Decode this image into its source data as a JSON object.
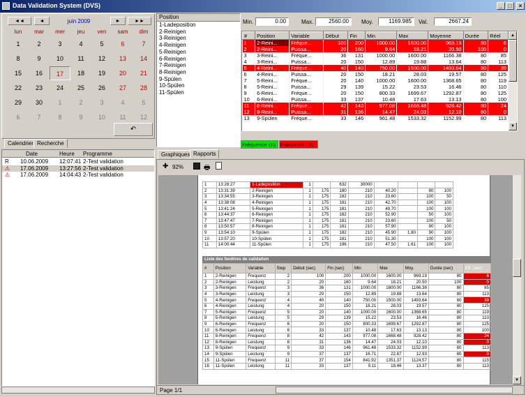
{
  "window": {
    "title": "Data Validation System (DVS)",
    "buttons": [
      "_",
      "□",
      "×"
    ]
  },
  "calendar": {
    "month_label": "juin 2009",
    "nav": [
      "◄◄",
      "◄",
      "►",
      "►►"
    ],
    "dows": [
      "lun",
      "mar",
      "mer",
      "jeu",
      "ven",
      "sam",
      "dim"
    ],
    "weeks": [
      [
        "1",
        "2",
        "3",
        "4",
        "5",
        "6",
        "7"
      ],
      [
        "8",
        "9",
        "10",
        "11",
        "12",
        "13",
        "14"
      ],
      [
        "15",
        "16",
        "17",
        "18",
        "19",
        "20",
        "21"
      ],
      [
        "22",
        "23",
        "24",
        "25",
        "26",
        "27",
        "28"
      ],
      [
        "29",
        "30",
        "1",
        "2",
        "3",
        "4",
        "5"
      ],
      [
        "6",
        "7",
        "8",
        "9",
        "10",
        "11",
        "12"
      ]
    ],
    "today": "17",
    "today_button": "↶",
    "tabs": [
      "Calendrier",
      "Recherche"
    ]
  },
  "positions": {
    "header": "Position",
    "items": [
      "1-Ladeposition",
      "2-Reinigen",
      "3-Reinigen",
      "4-Reinigen",
      "5-Reinigen",
      "6-Reinigen",
      "7-Reinigen",
      "8-Reinigen",
      "9-Spülen",
      "10-Spülen",
      "11-Spülen"
    ]
  },
  "stats": {
    "min_label": "Min.",
    "min": "0.00",
    "max_label": "Max.",
    "max": "2560.00",
    "moy_label": "Moy.",
    "moy": "1169.985",
    "val_label": "Val.",
    "val": "2667.24"
  },
  "grid": {
    "columns": [
      "#",
      "Position",
      "Variable",
      "Début",
      "Fin",
      "Min",
      "Max",
      "Moyenne",
      "Durée",
      "Réel"
    ],
    "rows": [
      {
        "c": [
          "1",
          "2-Reini...",
          "Fréque...",
          "100",
          "200",
          "1000.00",
          "1600.00",
          "969.19",
          "80",
          "6"
        ],
        "s": "selred"
      },
      {
        "c": [
          "2",
          "2-Reini...",
          "Puissa...",
          "20",
          "160",
          "9.64",
          "18.21",
          "20.50",
          "100",
          "0"
        ],
        "s": "red"
      },
      {
        "c": [
          "3",
          "3-Reini...",
          "Fréque...",
          "36",
          "131",
          "1000.00",
          "1600.00",
          "1166.38",
          "80",
          "85"
        ],
        "s": ""
      },
      {
        "c": [
          "4",
          "3-Reini...",
          "Puissa...",
          "20",
          "150",
          "12.89",
          "19.88",
          "13.64",
          "80",
          "113"
        ],
        "s": ""
      },
      {
        "c": [
          "5",
          "4-Reini...",
          "Fréque...",
          "40",
          "140",
          "750.00",
          "1500.00",
          "1493.64",
          "80",
          "39"
        ],
        "s": "red"
      },
      {
        "c": [
          "6",
          "4-Reini...",
          "Puissa...",
          "20",
          "150",
          "18.21",
          "28.03",
          "19.57",
          "80",
          "125"
        ],
        "s": ""
      },
      {
        "c": [
          "7",
          "5-Reini...",
          "Fréque...",
          "20",
          "140",
          "1000.00",
          "1600.00",
          "1368.65",
          "80",
          "119"
        ],
        "s": ""
      },
      {
        "c": [
          "8",
          "5-Reini...",
          "Puissa...",
          "29",
          "139",
          "15.22",
          "23.53",
          "16.46",
          "80",
          "110"
        ],
        "s": ""
      },
      {
        "c": [
          "9",
          "6-Reini...",
          "Fréque...",
          "20",
          "150",
          "800.33",
          "1699.67",
          "1292.87",
          "80",
          "125"
        ],
        "s": ""
      },
      {
        "c": [
          "10",
          "6-Reini...",
          "Puissa...",
          "33",
          "137",
          "10.48",
          "17.63",
          "13.13",
          "80",
          "100"
        ],
        "s": ""
      },
      {
        "c": [
          "11",
          "8-Reini...",
          "Fréque...",
          "42",
          "143",
          "977.08",
          "1668.48",
          "928.42",
          "80",
          "24"
        ],
        "s": "red"
      },
      {
        "c": [
          "12",
          "8-Reini...",
          "Puissa...",
          "31",
          "136",
          "14.47",
          "24.03",
          "12.10",
          "80",
          "0"
        ],
        "s": "red"
      },
      {
        "c": [
          "13",
          "9-Spülen",
          "Fréque...",
          "33",
          "146",
          "961.48",
          "1533.32",
          "1152.99",
          "80",
          "113"
        ],
        "s": ""
      }
    ]
  },
  "legend": {
    "freq": "Fréquence US",
    "power": "Puissance US"
  },
  "history": {
    "columns": [
      "Date",
      "Heure",
      "Programme"
    ],
    "rows": [
      {
        "flag": "R",
        "date": "10.06.2009",
        "time": "12:07:41",
        "prog": "2-Test validation",
        "sel": false
      },
      {
        "flag": "⚠",
        "date": "17.06.2009",
        "time": "13:27:56",
        "prog": "2-Test validation",
        "sel": true
      },
      {
        "flag": "⚠",
        "date": "17.06.2009",
        "time": "14:04:43",
        "prog": "2-Test validation",
        "sel": false
      }
    ]
  },
  "right_tabs": [
    "Graphiques",
    "Rapports"
  ],
  "toolbar": {
    "zoom": "92%"
  },
  "report1": {
    "rows": [
      [
        "1",
        "13:28:27",
        "1-Ladeposition",
        "1",
        "",
        "632",
        "30000",
        "",
        "",
        "",
        ""
      ],
      [
        "2",
        "13:31:39",
        "2-Reinigen",
        "1",
        "175",
        "180",
        "210",
        "40.20",
        "",
        "80",
        "100"
      ],
      [
        "3",
        "13:34:55",
        "3-Reinigen",
        "1",
        "175",
        "182",
        "210",
        "23.60",
        "",
        "100",
        "50"
      ],
      [
        "4",
        "13:38:08",
        "4-Reinigen",
        "1",
        "175",
        "181",
        "210",
        "42.70",
        "",
        "100",
        "100"
      ],
      [
        "5",
        "13:41:24",
        "5-Reinigen",
        "1",
        "175",
        "181",
        "210",
        "49.70",
        "",
        "100",
        "100"
      ],
      [
        "6",
        "13:44:37",
        "6-Reinigen",
        "1",
        "175",
        "182",
        "210",
        "52.90",
        "",
        "50",
        "100"
      ],
      [
        "7",
        "13:47:47",
        "7-Reinigen",
        "1",
        "175",
        "181",
        "210",
        "23.60",
        "",
        "100",
        "50"
      ],
      [
        "8",
        "13:50:57",
        "8-Reinigen",
        "1",
        "175",
        "181",
        "210",
        "57.90",
        "",
        "90",
        "100"
      ],
      [
        "9",
        "13:54:10",
        "9-Spülen",
        "1",
        "175",
        "182",
        "210",
        "45.90",
        "1.80",
        "90",
        "100"
      ],
      [
        "10",
        "13:57:20",
        "10-Spülen",
        "1",
        "175",
        "181",
        "210",
        "51.30",
        "",
        "100",
        "100"
      ],
      [
        "11",
        "14:00:44",
        "11-Spülen",
        "1",
        "175",
        "196",
        "210",
        "47.50",
        "1.61",
        "100",
        "100"
      ]
    ]
  },
  "report2": {
    "title": "Liste des fenêtres de validation",
    "columns": [
      "#",
      "Position",
      "Variable",
      "Step",
      "Début (sec)",
      "Fin (sec)",
      "Min",
      "Max",
      "Moy.",
      "Durée (sec)",
      "Eff. (sec)"
    ],
    "rows": [
      {
        "c": [
          "1",
          "2-Reinigen",
          "Frequenz",
          "2",
          "100",
          "200",
          "1000.00",
          "1600.00",
          "969.19",
          "80",
          "6"
        ],
        "r": true
      },
      {
        "c": [
          "2",
          "2-Reinigen",
          "Leistung",
          "2",
          "20",
          "160",
          "9.64",
          "18.21",
          "20.50",
          "100",
          "0"
        ],
        "r": true
      },
      {
        "c": [
          "3",
          "3-Reinigen",
          "Frequenz",
          "3",
          "36",
          "131",
          "1000.00",
          "1600.00",
          "1166.38",
          "80",
          "85"
        ],
        "r": false
      },
      {
        "c": [
          "4",
          "3-Reinigen",
          "Leistung",
          "3",
          "20",
          "150",
          "12.89",
          "19.88",
          "13.64",
          "80",
          "113"
        ],
        "r": false
      },
      {
        "c": [
          "5",
          "4-Reinigen",
          "Frequenz",
          "4",
          "40",
          "140",
          "750.00",
          "1500.00",
          "1493.64",
          "80",
          "39"
        ],
        "r": true
      },
      {
        "c": [
          "6",
          "4-Reinigen",
          "Leistung",
          "4",
          "20",
          "150",
          "18.21",
          "28.03",
          "19.57",
          "80",
          "125"
        ],
        "r": false
      },
      {
        "c": [
          "7",
          "5-Reinigen",
          "Frequenz",
          "5",
          "20",
          "140",
          "1000.00",
          "1600.00",
          "1368.65",
          "80",
          "119"
        ],
        "r": false
      },
      {
        "c": [
          "8",
          "5-Reinigen",
          "Leistung",
          "5",
          "29",
          "139",
          "15.22",
          "23.53",
          "16.46",
          "80",
          "110"
        ],
        "r": false
      },
      {
        "c": [
          "9",
          "6-Reinigen",
          "Frequenz",
          "6",
          "20",
          "150",
          "800.33",
          "1699.67",
          "1292.87",
          "80",
          "125"
        ],
        "r": false
      },
      {
        "c": [
          "10",
          "6-Reinigen",
          "Leistung",
          "6",
          "33",
          "137",
          "10.48",
          "17.63",
          "13.13",
          "80",
          "100"
        ],
        "r": false
      },
      {
        "c": [
          "11",
          "8-Reinigen",
          "Frequenz",
          "8",
          "42",
          "143",
          "977.08",
          "1668.48",
          "928.42",
          "80",
          "24"
        ],
        "r": true
      },
      {
        "c": [
          "12",
          "8-Reinigen",
          "Leistung",
          "8",
          "31",
          "136",
          "14.47",
          "24.03",
          "12.10",
          "80",
          "0"
        ],
        "r": true
      },
      {
        "c": [
          "13",
          "9-Spülen",
          "Frequenz",
          "9",
          "33",
          "146",
          "961.48",
          "1533.32",
          "1152.99",
          "80",
          "113"
        ],
        "r": false
      },
      {
        "c": [
          "14",
          "9-Spülen",
          "Leistung",
          "9",
          "37",
          "137",
          "16.71",
          "22.87",
          "12.93",
          "80",
          "0"
        ],
        "r": true
      },
      {
        "c": [
          "15",
          "11-Spülen",
          "Frequenz",
          "11",
          "37",
          "154",
          "841.92",
          "1351.37",
          "1124.57",
          "80",
          "115"
        ],
        "r": false
      },
      {
        "c": [
          "16",
          "11-Spülen",
          "Leistung",
          "11",
          "33",
          "137",
          "9.11",
          "18.46",
          "13.37",
          "80",
          "113"
        ],
        "r": false
      }
    ]
  },
  "status": {
    "page": "Page 1/1"
  }
}
